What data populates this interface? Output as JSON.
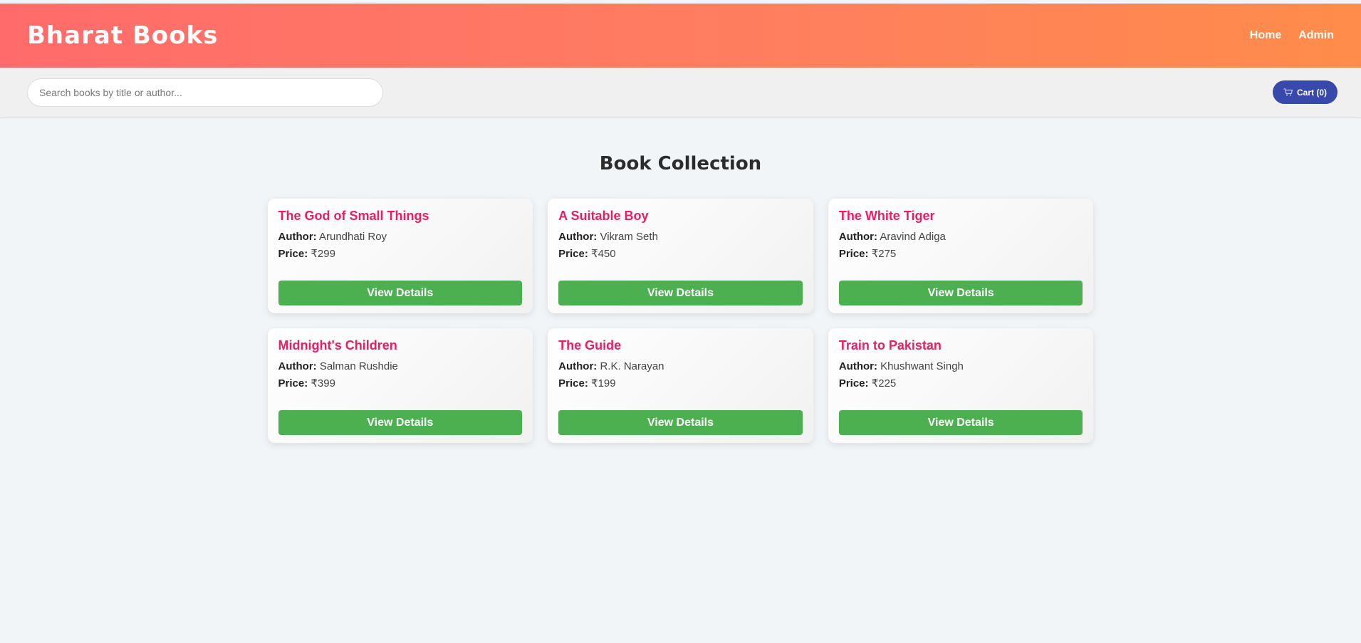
{
  "header": {
    "brand": "Bharat Books",
    "nav": [
      {
        "label": "Home"
      },
      {
        "label": "Admin"
      }
    ]
  },
  "toolbar": {
    "search_placeholder": "Search books by title or author...",
    "search_value": "",
    "cart_label": "Cart (0)",
    "cart_icon": "shopping-cart-icon"
  },
  "main": {
    "title": "Book Collection",
    "author_label": "Author:",
    "price_label": "Price:",
    "button_label": "View Details",
    "books": [
      {
        "title": "The God of Small Things",
        "author": "Arundhati Roy",
        "price": "₹299"
      },
      {
        "title": "A Suitable Boy",
        "author": "Vikram Seth",
        "price": "₹450"
      },
      {
        "title": "The White Tiger",
        "author": "Aravind Adiga",
        "price": "₹275"
      },
      {
        "title": "Midnight's Children",
        "author": "Salman Rushdie",
        "price": "₹399"
      },
      {
        "title": "The Guide",
        "author": "R.K. Narayan",
        "price": "₹199"
      },
      {
        "title": "Train to Pakistan",
        "author": "Khushwant Singh",
        "price": "₹225"
      }
    ]
  },
  "colors": {
    "header_gradient_start": "#ff6b6b",
    "header_gradient_end": "#ff8c4a",
    "cart_button": "#3949ab",
    "book_title": "#e91e63",
    "details_button": "#4caf50"
  }
}
